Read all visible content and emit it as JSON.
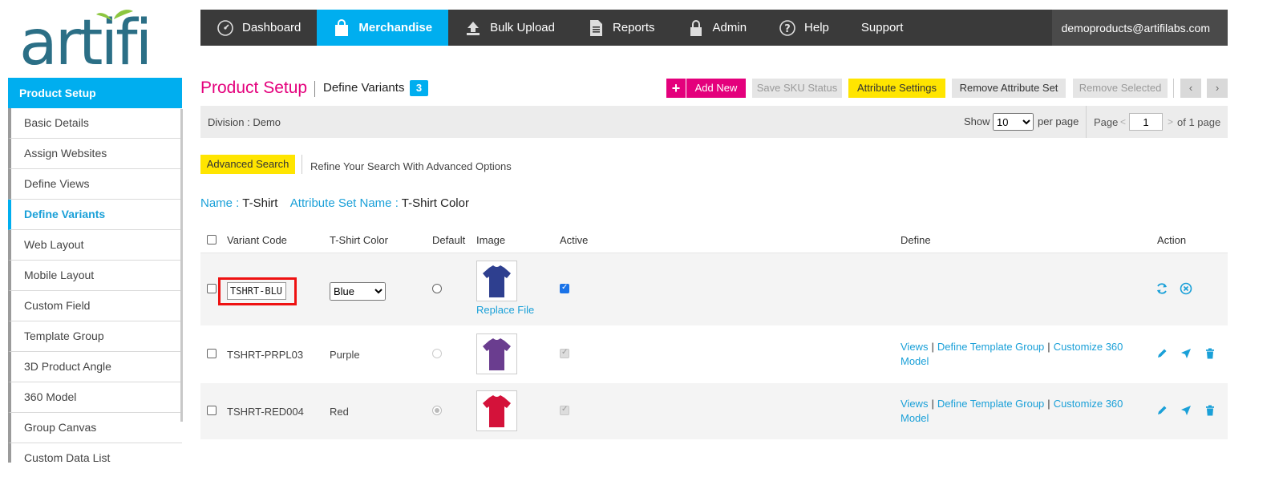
{
  "logo": {
    "text": "artifi"
  },
  "nav": {
    "items": [
      {
        "label": "Dashboard",
        "icon": "gauge-icon"
      },
      {
        "label": "Merchandise",
        "icon": "shopping-bag-icon"
      },
      {
        "label": "Bulk Upload",
        "icon": "upload-icon"
      },
      {
        "label": "Reports",
        "icon": "document-icon"
      },
      {
        "label": "Admin",
        "icon": "lock-icon"
      },
      {
        "label": "Help",
        "icon": "help-circle-icon"
      },
      {
        "label": "Support",
        "icon": ""
      }
    ],
    "user": "demoproducts@artifilabs.com"
  },
  "sidebar": {
    "title": "Product Setup",
    "items": [
      {
        "label": "Basic Details"
      },
      {
        "label": "Assign Websites"
      },
      {
        "label": "Define Views"
      },
      {
        "label": "Define Variants"
      },
      {
        "label": "Web Layout"
      },
      {
        "label": "Mobile Layout"
      },
      {
        "label": "Custom Field"
      },
      {
        "label": "Template Group"
      },
      {
        "label": "3D Product Angle"
      },
      {
        "label": "360 Model"
      },
      {
        "label": "Group Canvas"
      },
      {
        "label": "Custom Data List"
      }
    ]
  },
  "header": {
    "title": "Product Setup",
    "subtitle": "Define Variants",
    "count": "3"
  },
  "toolbar": {
    "add_plus": "+",
    "add_new": "Add New",
    "save_sku": "Save SKU Status",
    "attribute_settings": "Attribute Settings",
    "remove_attribute_set": "Remove Attribute Set",
    "remove_selected": "Remove Selected",
    "prev": "‹",
    "next": "›"
  },
  "divisionBar": {
    "division": "Division :  Demo",
    "show": "Show",
    "per_page_value": "10",
    "per_page": "per page",
    "page_label": "Page",
    "prev_arrow": "<",
    "page_value": "1",
    "next_arrow": ">",
    "of_pages": "of 1 page"
  },
  "search": {
    "advanced": "Advanced Search",
    "hint": "Refine Your Search With Advanced Options"
  },
  "product": {
    "name_label": "Name :",
    "name_value": "T-Shirt",
    "attr_label": "Attribute Set Name :",
    "attr_value": "T-Shirt Color"
  },
  "table": {
    "headers": {
      "code": "Variant Code",
      "color": "T-Shirt Color",
      "default": "Default",
      "image": "Image",
      "active": "Active",
      "define": "Define",
      "action": "Action"
    },
    "rows": [
      {
        "code": "TSHRT-BLU",
        "color": "Blue",
        "shirt_color": "#2e3f8f",
        "image_link": "Replace File"
      },
      {
        "code": "TSHRT-PRPL03",
        "color": "Purple",
        "shirt_color": "#6a3d8f",
        "views": "Views",
        "template_group": "Define Template Group",
        "customize": "Customize 360 Model"
      },
      {
        "code": "TSHRT-RED004",
        "color": "Red",
        "shirt_color": "#d4123a",
        "views": "Views",
        "template_group": "Define Template Group",
        "customize": "Customize 360 Model"
      }
    ]
  },
  "colors": {
    "accent": "#00aeef",
    "brand_pink": "#e4007c",
    "highlight": "#ffe500",
    "nav_bg": "#3a3a3a"
  }
}
